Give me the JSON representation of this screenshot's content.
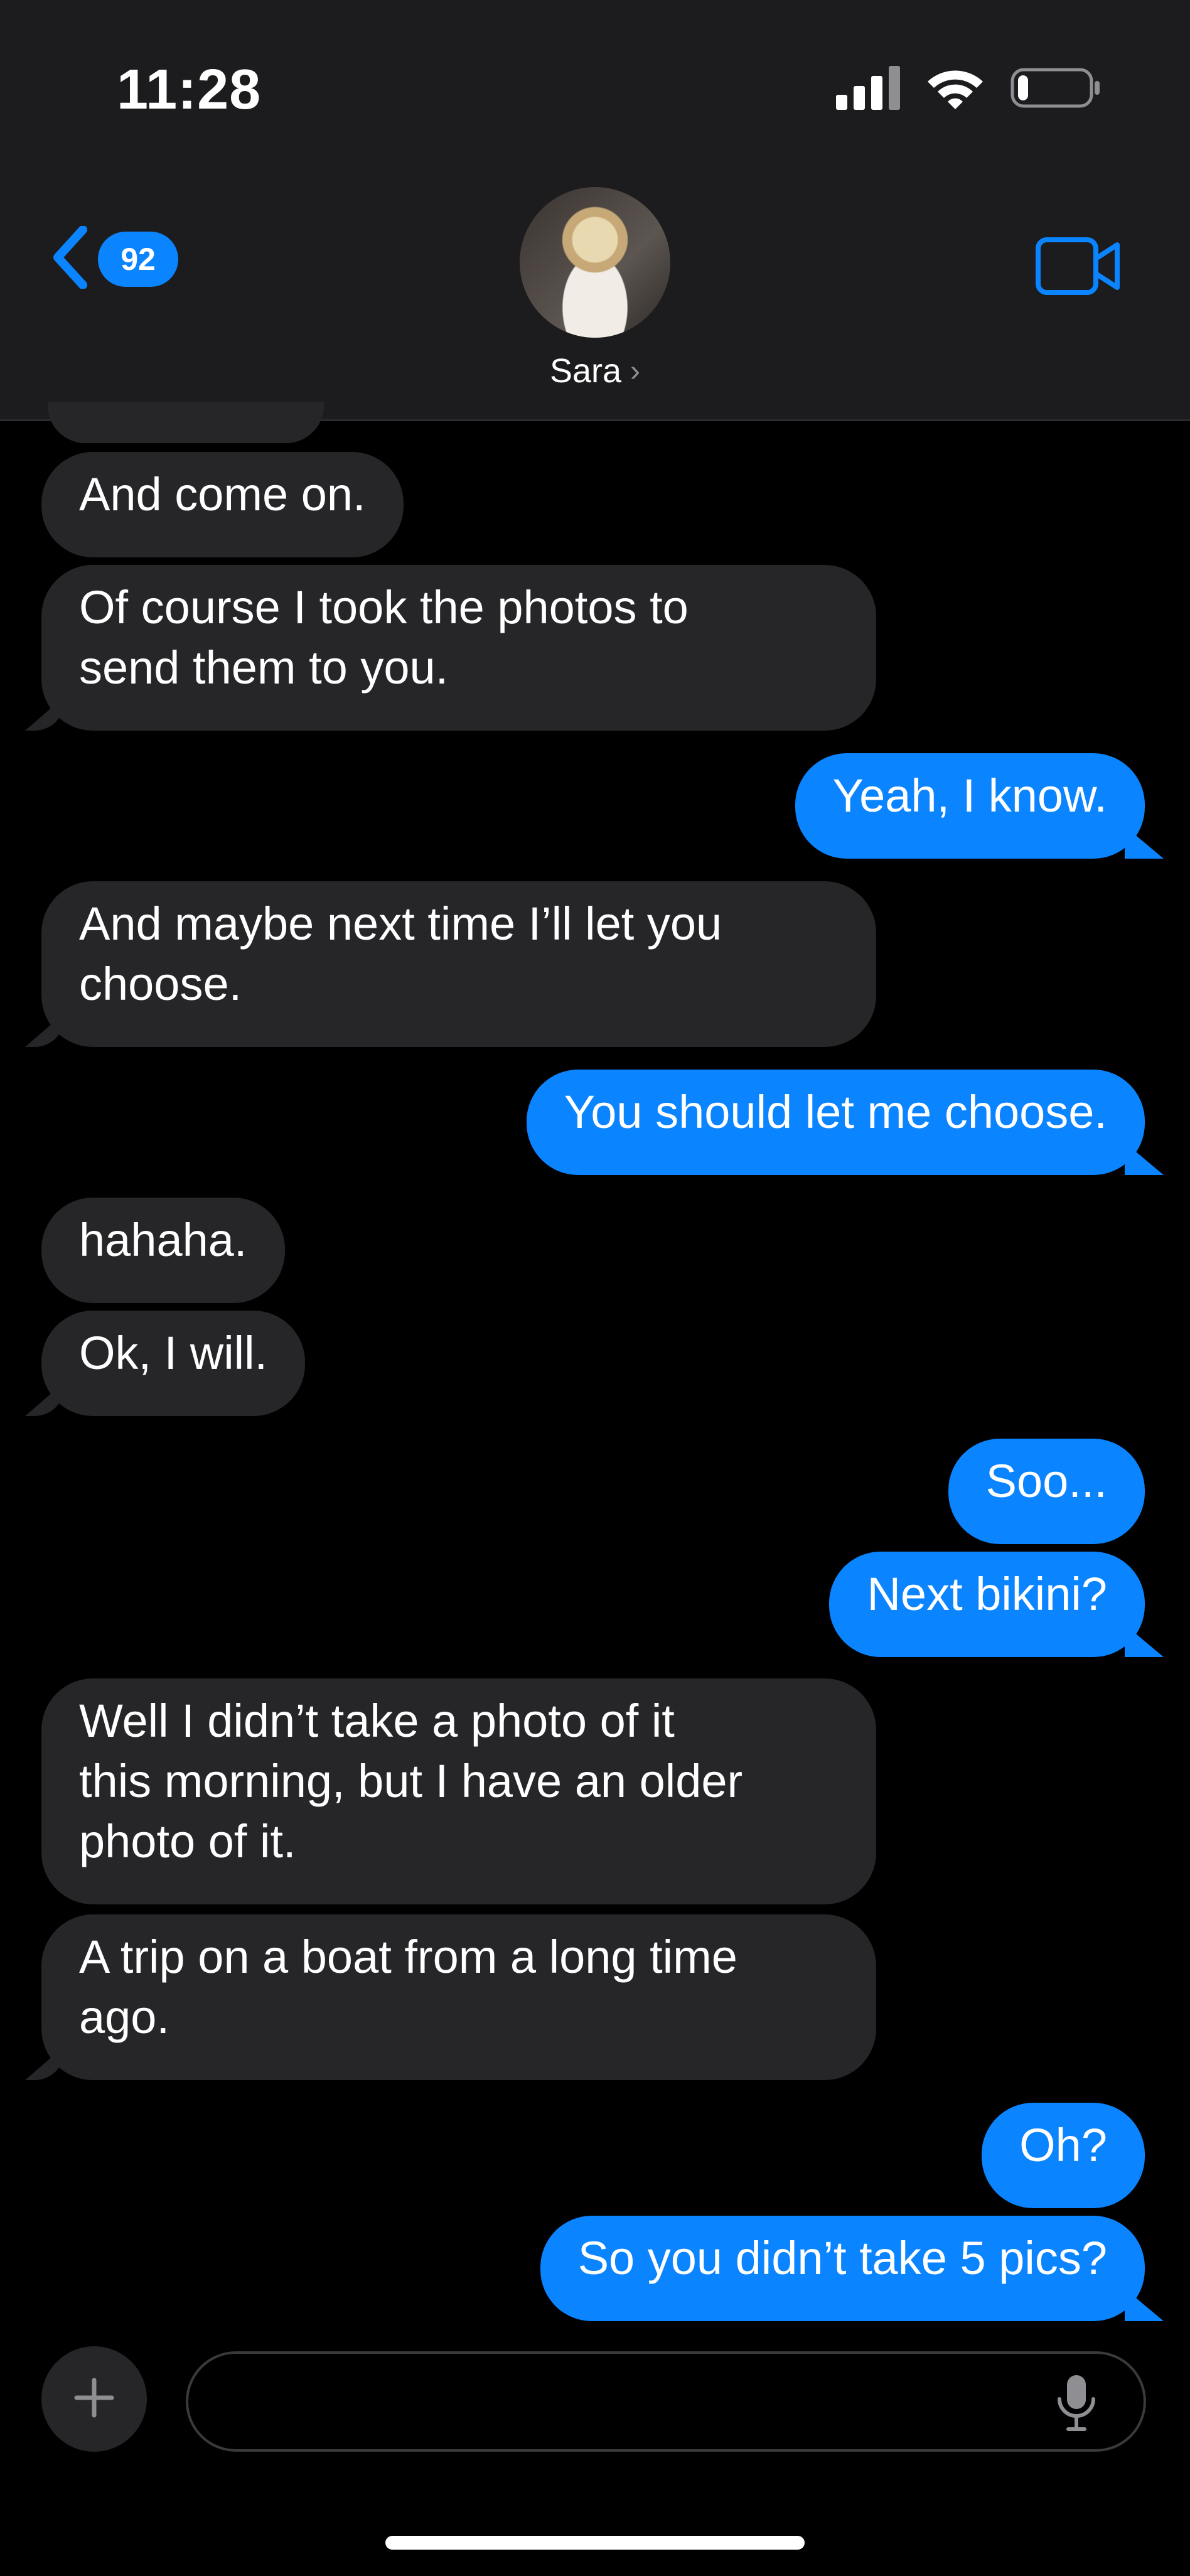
{
  "status_bar": {
    "time": "11:28",
    "battery_level": 0.15
  },
  "header": {
    "back_badge": "92",
    "contact_name": "Sara",
    "chevron": "›",
    "icons": [
      "chevron-left-icon",
      "video-camera-icon"
    ],
    "accent_color": "#0a84ff"
  },
  "messages": [
    {
      "dir": "in",
      "lines": [
        "And come on."
      ]
    },
    {
      "dir": "in",
      "lines": [
        "Of course I took the photos to",
        "send them to you."
      ]
    },
    {
      "dir": "out",
      "lines": [
        "Yeah, I know."
      ]
    },
    {
      "dir": "in",
      "lines": [
        "And maybe next time I’ll let you",
        "choose."
      ]
    },
    {
      "dir": "out",
      "lines": [
        "You should let me choose."
      ]
    },
    {
      "dir": "in",
      "lines": [
        "hahaha."
      ]
    },
    {
      "dir": "in",
      "lines": [
        "Ok, I will."
      ]
    },
    {
      "dir": "out",
      "lines": [
        "Soo..."
      ]
    },
    {
      "dir": "out",
      "lines": [
        "Next bikini?"
      ]
    },
    {
      "dir": "in",
      "lines": [
        "Well I didn’t take a photo of it",
        "this morning, but I have an older",
        "photo of it."
      ]
    },
    {
      "dir": "in",
      "lines": [
        "A trip on a boat from a long time",
        "ago."
      ]
    },
    {
      "dir": "out",
      "lines": [
        "Oh?"
      ]
    },
    {
      "dir": "out",
      "lines": [
        "So you didn’t take 5 pics?"
      ]
    }
  ],
  "composer": {
    "value": "",
    "icons": [
      "plus-icon",
      "microphone-icon"
    ]
  },
  "colors": {
    "incoming_bubble": "#262629",
    "outgoing_bubble": "#0a84ff",
    "background": "#000000"
  }
}
